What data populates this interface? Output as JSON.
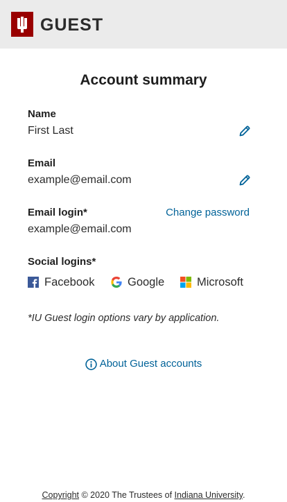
{
  "header": {
    "brand": "GUEST",
    "logo_icon": "iu-trident-icon"
  },
  "page": {
    "title": "Account summary"
  },
  "name": {
    "label": "Name",
    "value": "First Last",
    "edit_icon": "pencil-icon"
  },
  "email": {
    "label": "Email",
    "value": "example@email.com",
    "edit_icon": "pencil-icon"
  },
  "email_login": {
    "label": "Email login*",
    "value": "example@email.com",
    "change_password_label": "Change password"
  },
  "social_logins": {
    "label": "Social logins*",
    "items": [
      {
        "label": "Facebook",
        "icon": "facebook-icon"
      },
      {
        "label": "Google",
        "icon": "google-icon"
      },
      {
        "label": "Microsoft",
        "icon": "microsoft-icon"
      }
    ]
  },
  "note": "*IU Guest login options vary by application.",
  "about": {
    "label": "About Guest accounts",
    "icon": "info-icon"
  },
  "footer": {
    "copyright_link": "Copyright",
    "middle": " © 2020 The Trustees of ",
    "university_link": "Indiana University",
    "end": "."
  },
  "colors": {
    "brand_red": "#990000",
    "link_blue": "#006298",
    "header_bg": "#ebebeb"
  }
}
